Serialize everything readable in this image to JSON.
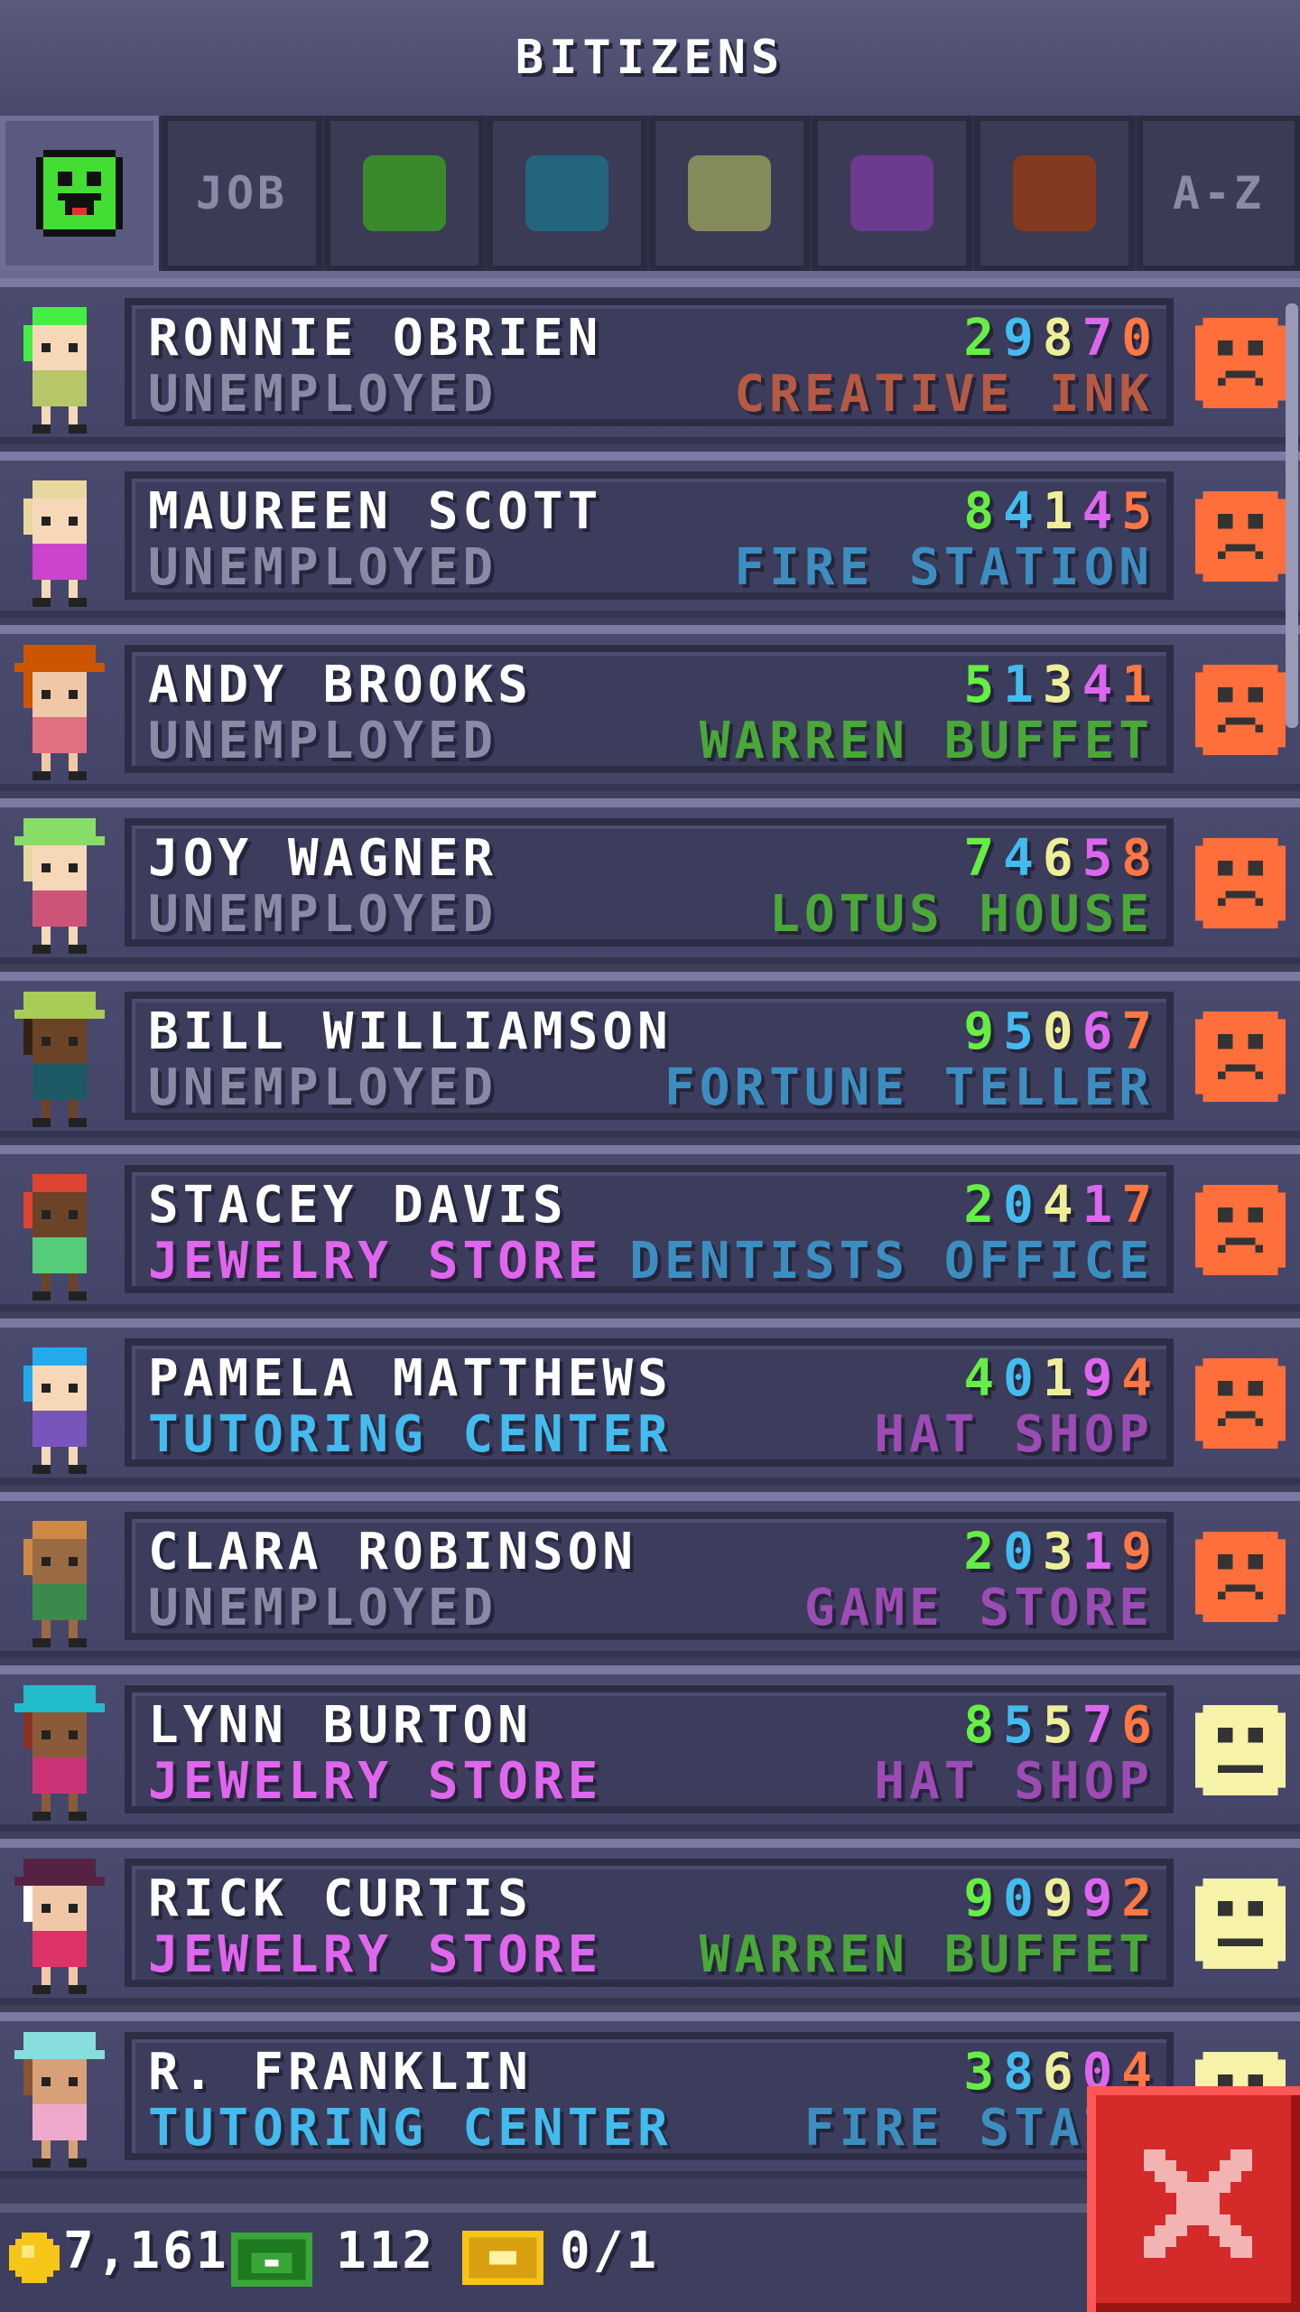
{
  "header": {
    "title": "BITIZENS"
  },
  "tabs": [
    {
      "kind": "smiley",
      "label": "",
      "color": "#44dd33"
    },
    {
      "kind": "text",
      "label": "JOB"
    },
    {
      "kind": "swatch",
      "label": "",
      "color": "#3a8a2c"
    },
    {
      "kind": "swatch",
      "label": "",
      "color": "#23657f"
    },
    {
      "kind": "swatch",
      "label": "",
      "color": "#858a5a"
    },
    {
      "kind": "swatch",
      "label": "",
      "color": "#6c3a8e"
    },
    {
      "kind": "swatch",
      "label": "",
      "color": "#843a1e"
    },
    {
      "kind": "text",
      "label": "A-Z"
    }
  ],
  "digit_colors": [
    "#66ee44",
    "#44bbee",
    "#eeee99",
    "#dd66ee",
    "#ff7744"
  ],
  "bitizens": [
    {
      "name": "RONNIE OBRIEN",
      "job": "UNEMPLOYED",
      "job_color": "#8a8aa6",
      "digits": "29870",
      "dream_job": "CREATIVE INK",
      "dream_color": "#b65a44",
      "mood": "sad",
      "hair": "#44ee44",
      "skin": "#f6d8b8",
      "shirt": "#b8c66a",
      "hat": ""
    },
    {
      "name": "MAUREEN SCOTT",
      "job": "UNEMPLOYED",
      "job_color": "#8a8aa6",
      "digits": "84145",
      "dream_job": "FIRE STATION",
      "dream_color": "#3c8ec0",
      "mood": "sad",
      "hair": "#e8d8a0",
      "skin": "#f6d8b8",
      "shirt": "#cc44cc",
      "hat": ""
    },
    {
      "name": "ANDY BROOKS",
      "job": "UNEMPLOYED",
      "job_color": "#8a8aa6",
      "digits": "51341",
      "dream_job": "WARREN BUFFET",
      "dream_color": "#4aa838",
      "mood": "sad",
      "hair": "#cc5500",
      "skin": "#f0c8a8",
      "shirt": "#e07080",
      "hat": "#cc5500"
    },
    {
      "name": "JOY WAGNER",
      "job": "UNEMPLOYED",
      "job_color": "#8a8aa6",
      "digits": "74658",
      "dream_job": "LOTUS HOUSE",
      "dream_color": "#4aa838",
      "mood": "sad",
      "hair": "#e8d8a0",
      "skin": "#f6d8b8",
      "shirt": "#cc5577",
      "hat": "#88dd66"
    },
    {
      "name": "BILL WILLIAMSON",
      "job": "UNEMPLOYED",
      "job_color": "#8a8aa6",
      "digits": "95067",
      "dream_job": "FORTUNE TELLER",
      "dream_color": "#3c8ec0",
      "mood": "sad",
      "hair": "#332211",
      "skin": "#6b4428",
      "shirt": "#1e5a66",
      "hat": "#a8cc55"
    },
    {
      "name": "STACEY DAVIS",
      "job": "JEWELRY STORE",
      "job_color": "#e066ee",
      "digits": "20417",
      "dream_job": "DENTISTS OFFICE",
      "dream_color": "#3c8ec0",
      "mood": "sad",
      "hair": "#dd4433",
      "skin": "#6b4428",
      "shirt": "#55cc77",
      "hat": ""
    },
    {
      "name": "PAMELA MATTHEWS",
      "job": "TUTORING CENTER",
      "job_color": "#44bbee",
      "digits": "40194",
      "dream_job": "HAT SHOP",
      "dream_color": "#9c4cb4",
      "mood": "sad",
      "hair": "#22aaee",
      "skin": "#f6d8b8",
      "shirt": "#7755bb",
      "hat": ""
    },
    {
      "name": "CLARA ROBINSON",
      "job": "UNEMPLOYED",
      "job_color": "#8a8aa6",
      "digits": "20319",
      "dream_job": "GAME STORE",
      "dream_color": "#9c4cb4",
      "mood": "sad",
      "hair": "#cc8844",
      "skin": "#9a6a44",
      "shirt": "#3a8a4c",
      "hat": ""
    },
    {
      "name": "LYNN BURTON",
      "job": "JEWELRY STORE",
      "job_color": "#e066ee",
      "digits": "85576",
      "dream_job": "HAT SHOP",
      "dream_color": "#9c4cb4",
      "mood": "neutral",
      "hair": "#883322",
      "skin": "#8a5a3a",
      "shirt": "#cc3377",
      "hat": "#22bbcc"
    },
    {
      "name": "RICK CURTIS",
      "job": "JEWELRY STORE",
      "job_color": "#e066ee",
      "digits": "90992",
      "dream_job": "WARREN BUFFET",
      "dream_color": "#4aa838",
      "mood": "neutral",
      "hair": "#ffffff",
      "skin": "#f0c8a8",
      "shirt": "#dd3366",
      "hat": "#552244"
    },
    {
      "name": "R. FRANKLIN",
      "job": "TUTORING CENTER",
      "job_color": "#44bbee",
      "digits": "38604",
      "dream_job": "FIRE STATI",
      "dream_color": "#3c8ec0",
      "mood": "neutral",
      "hair": "#885533",
      "skin": "#d8a078",
      "shirt": "#eeaacc",
      "hat": "#88dddd"
    }
  ],
  "mood_colors": {
    "sad": "#ff6f3c",
    "neutral": "#f6f2a8"
  },
  "footer": {
    "coins": "7,161",
    "bux": "112",
    "tickets": "0/1"
  },
  "close_button": {
    "icon": "close-x-icon",
    "color": "#d42a2a"
  }
}
